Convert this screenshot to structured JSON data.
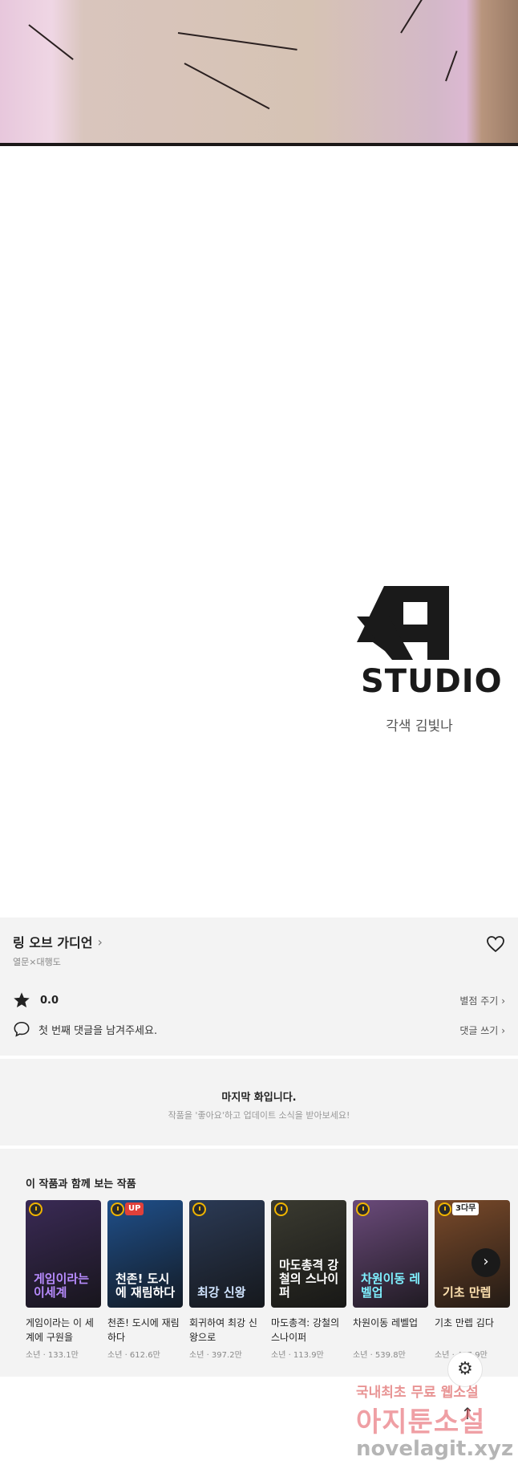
{
  "logo": {
    "studio_text": "STUDIO",
    "credit": "각색 김빛나"
  },
  "work": {
    "title": "링 오브 가디언",
    "authors": "열문×대행도",
    "rating": "0.0",
    "rate_link": "별점 주기",
    "comment_prompt": "첫 번째 댓글을 남겨주세요.",
    "comment_link": "댓글 쓰기"
  },
  "last_episode": {
    "title": "마지막 화입니다.",
    "subtitle": "작품을 '좋아요'하고 업데이트 소식을 받아보세요!"
  },
  "recommendations": {
    "heading": "이 작품과 함께 보는 작품",
    "items": [
      {
        "title": "게임이라는 이 세계에 구원을",
        "meta": "소년 · 133.1만",
        "badge": "",
        "art": "게임이라는 이세계",
        "bg": "#3a2a55",
        "art_color": "#b88cff"
      },
      {
        "title": "천존! 도시에 재림하다",
        "meta": "소년 · 612.6만",
        "badge": "UP",
        "art": "천존! 도시에 재림하다",
        "bg": "#1f4f8a",
        "art_color": "#ffffff"
      },
      {
        "title": "회귀하여 최강 신왕으로",
        "meta": "소년 · 397.2만",
        "badge": "",
        "art": "최강 신왕",
        "bg": "#2b3a55",
        "art_color": "#d0e4ff"
      },
      {
        "title": "마도총격: 강철의 스나이퍼",
        "meta": "소년 · 113.9만",
        "badge": "",
        "art": "마도총격 강철의 스나이퍼",
        "bg": "#3a3a30",
        "art_color": "#ffffff"
      },
      {
        "title": "차원이동 레벨업",
        "meta": "소년 · 539.8만",
        "badge": "",
        "art": "차원이동 레벨업",
        "bg": "#6a4a7a",
        "art_color": "#7ff0ff"
      },
      {
        "title": "기초 만렙 김다",
        "meta": "소년 · 407.9만",
        "badge": "3다무",
        "art": "기초 만렙",
        "bg": "#7a4a2a",
        "art_color": "#ffe2b0"
      }
    ]
  },
  "watermark": {
    "line1": "국내최초 무료 웹소설",
    "line2": "아지툰소설",
    "line3": "novelagit.xyz"
  },
  "colors": {
    "panel_bg": "#f3f3f3",
    "accent_clock": "#f0b400",
    "badge_up": "#e0403a"
  },
  "icons": [
    "heart-icon",
    "star-icon",
    "comment-bubble-icon",
    "chevron-right-icon",
    "settings-gear-icon",
    "scroll-top-icon",
    "clock-icon"
  ]
}
